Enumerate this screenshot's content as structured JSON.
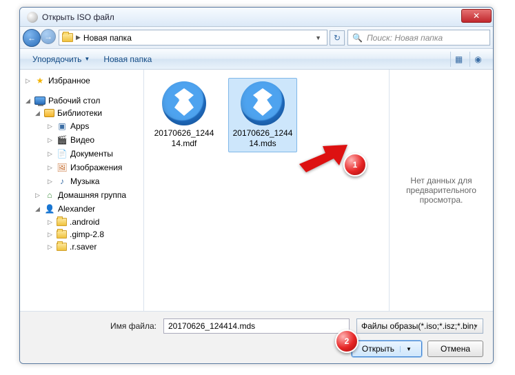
{
  "window": {
    "title": "Открыть ISO файл"
  },
  "nav": {
    "breadcrumb": "Новая папка",
    "search_placeholder": "Поиск: Новая папка"
  },
  "toolbar": {
    "organize": "Упорядочить",
    "new_folder": "Новая папка"
  },
  "sidebar": {
    "favorites": "Избранное",
    "desktop": "Рабочий стол",
    "libraries": "Библиотеки",
    "apps": "Apps",
    "video": "Видео",
    "documents": "Документы",
    "pictures": "Изображения",
    "music": "Музыка",
    "homegroup": "Домашняя группа",
    "user": "Alexander",
    "f1": ".android",
    "f2": ".gimp-2.8",
    "f3": ".r.saver"
  },
  "files": [
    {
      "name": "20170626_124414.mdf"
    },
    {
      "name": "20170626_124414.mds"
    }
  ],
  "preview": {
    "empty": "Нет данных для предварительного просмотра."
  },
  "footer": {
    "filename_label": "Имя файла:",
    "filename_value": "20170626_124414.mds",
    "filter": "Файлы образы(*.iso;*.isz;*.bin;",
    "open": "Открыть",
    "cancel": "Отмена"
  },
  "callouts": {
    "one": "1",
    "two": "2"
  }
}
